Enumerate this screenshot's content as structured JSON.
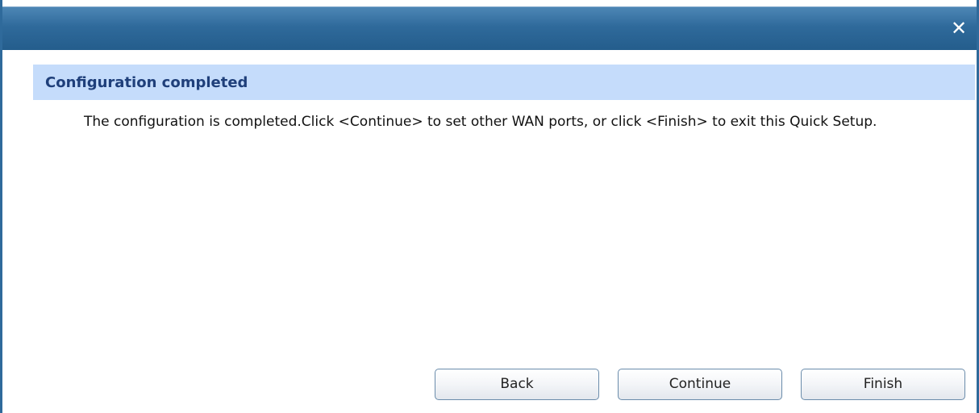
{
  "titlebar": {
    "close_glyph": "✕"
  },
  "section": {
    "title": "Configuration completed"
  },
  "message": {
    "text": "The configuration is completed.Click <Continue> to set other WAN ports, or click <Finish> to exit this Quick Setup."
  },
  "buttons": {
    "back": "Back",
    "continue": "Continue",
    "finish": "Finish"
  },
  "colors": {
    "titlebar": "#2f6a9b",
    "section_header_bg": "#c5dcfb",
    "section_title_text": "#1f3f7a"
  }
}
